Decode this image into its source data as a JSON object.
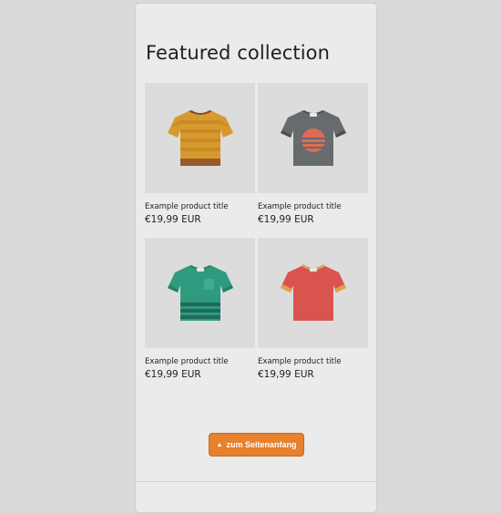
{
  "section": {
    "title": "Featured collection"
  },
  "products": [
    {
      "title": "Example product title",
      "price": "€19,99 EUR",
      "icon": "striped-orange-tshirt-icon"
    },
    {
      "title": "Example product title",
      "price": "€19,99 EUR",
      "icon": "gray-sunset-tshirt-icon"
    },
    {
      "title": "Example product title",
      "price": "€19,99 EUR",
      "icon": "teal-pocket-tshirt-icon"
    },
    {
      "title": "Example product title",
      "price": "€19,99 EUR",
      "icon": "red-ringer-tshirt-icon"
    }
  ],
  "scroll_top_button": {
    "label": "zum Seitenanfang",
    "icon": "arrow-up-icon",
    "color": "#e6812e"
  }
}
